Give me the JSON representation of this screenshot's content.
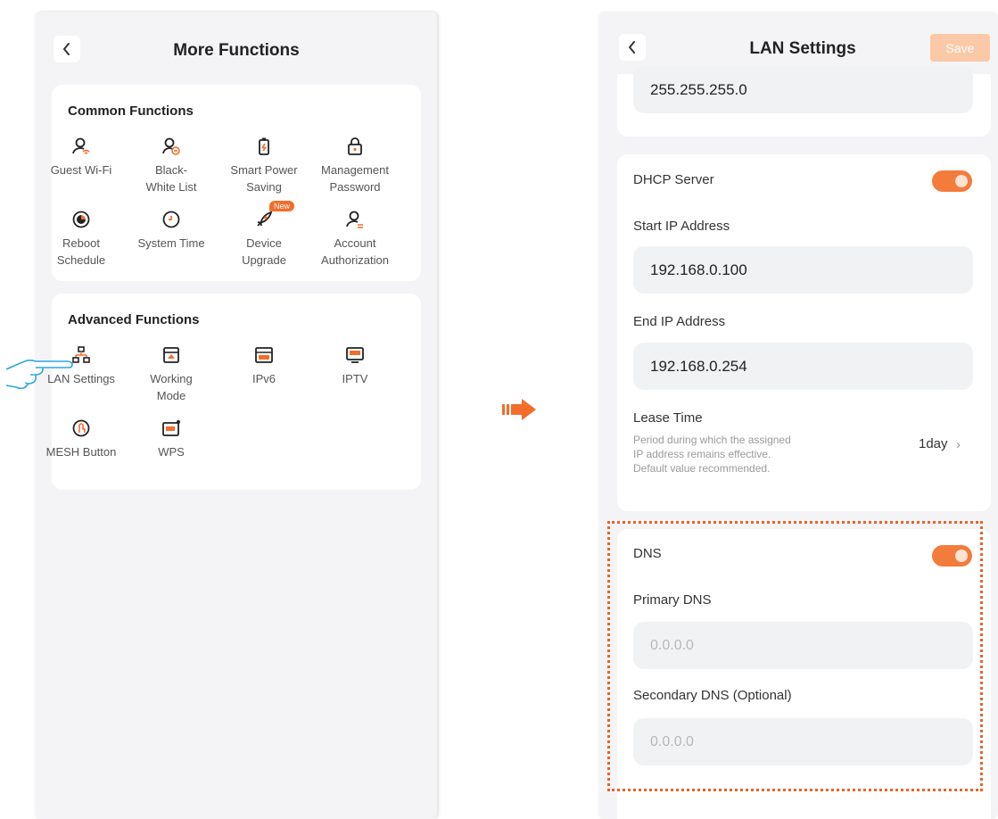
{
  "left": {
    "title": "More Functions",
    "common": {
      "title": "Common Functions",
      "items": [
        {
          "label": "Guest Wi-Fi",
          "icon": "guest-wifi-icon"
        },
        {
          "label": "Black-\nWhite List",
          "icon": "black-white-list-icon"
        },
        {
          "label": "Smart Power\nSaving",
          "icon": "smart-power-saving-icon"
        },
        {
          "label": "Management\nPassword",
          "icon": "lock-icon"
        },
        {
          "label": "Reboot\nSchedule",
          "icon": "reboot-schedule-icon"
        },
        {
          "label": "System Time",
          "icon": "clock-icon"
        },
        {
          "label": "Device\nUpgrade",
          "icon": "rocket-icon",
          "badge": "New"
        },
        {
          "label": "Account\nAuthorization",
          "icon": "account-authorization-icon"
        }
      ]
    },
    "advanced": {
      "title": "Advanced Functions",
      "items": [
        {
          "label": "LAN Settings",
          "icon": "lan-settings-icon"
        },
        {
          "label": "Working\nMode",
          "icon": "working-mode-icon"
        },
        {
          "label": "IPv6",
          "icon": "ipv6-icon"
        },
        {
          "label": "IPTV",
          "icon": "iptv-icon"
        },
        {
          "label": "MESH Button",
          "icon": "mesh-button-icon"
        },
        {
          "label": "WPS",
          "icon": "wps-icon"
        }
      ]
    }
  },
  "right": {
    "title": "LAN Settings",
    "save_label": "Save",
    "subnet_mask": "255.255.255.0",
    "dhcp": {
      "label": "DHCP Server",
      "enabled": true,
      "start_label": "Start IP Address",
      "start_value": "192.168.0.100",
      "end_label": "End IP Address",
      "end_value": "192.168.0.254",
      "lease_label": "Lease Time",
      "lease_hint": "Period during which the assigned\nIP address remains effective.\nDefault value recommended.",
      "lease_value": "1day"
    },
    "dns": {
      "label": "DNS",
      "enabled": true,
      "primary_label": "Primary DNS",
      "primary_placeholder": "0.0.0.0",
      "secondary_label": "Secondary DNS (Optional)",
      "secondary_placeholder": "0.0.0.0"
    }
  },
  "colors": {
    "accent": "#f37b3c",
    "highlight_border": "#e8632a",
    "icon_orange": "#f36d2b"
  }
}
